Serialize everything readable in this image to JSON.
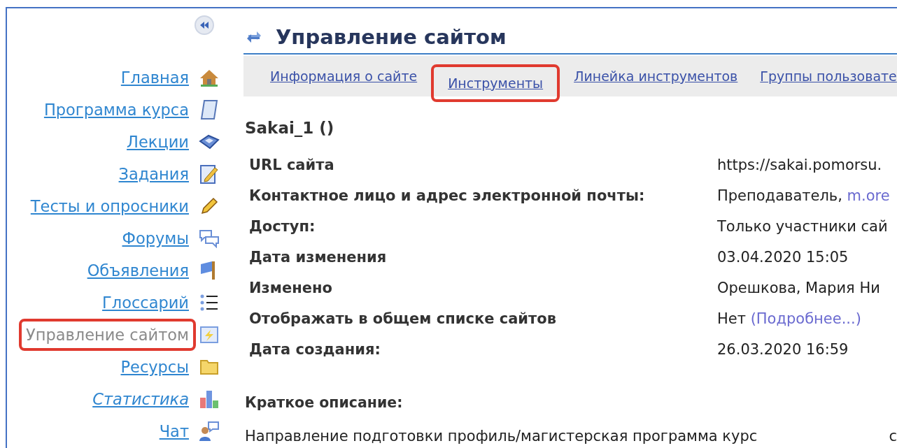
{
  "sidebar": {
    "items": [
      {
        "label": "Главная",
        "selected": false,
        "italic": false,
        "highlighted": false
      },
      {
        "label": "Программа курса",
        "selected": false,
        "italic": false,
        "highlighted": false
      },
      {
        "label": "Лекции",
        "selected": false,
        "italic": false,
        "highlighted": false
      },
      {
        "label": "Задания",
        "selected": false,
        "italic": false,
        "highlighted": false
      },
      {
        "label": "Тесты и опросники",
        "selected": false,
        "italic": false,
        "highlighted": false
      },
      {
        "label": "Форумы",
        "selected": false,
        "italic": false,
        "highlighted": false
      },
      {
        "label": "Объявления",
        "selected": false,
        "italic": false,
        "highlighted": false
      },
      {
        "label": "Глоссарий",
        "selected": false,
        "italic": false,
        "highlighted": false
      },
      {
        "label": "Управление сайтом",
        "selected": true,
        "italic": false,
        "highlighted": true
      },
      {
        "label": "Ресурсы",
        "selected": false,
        "italic": false,
        "highlighted": false
      },
      {
        "label": "Статистика",
        "selected": false,
        "italic": true,
        "highlighted": false
      },
      {
        "label": "Чат",
        "selected": false,
        "italic": false,
        "highlighted": false
      }
    ]
  },
  "page": {
    "title": "Управление сайтом",
    "tabs": [
      {
        "label": "Информация о сайте",
        "highlighted": false
      },
      {
        "label": "Инструменты",
        "highlighted": true
      },
      {
        "label": "Линейка инструментов",
        "highlighted": false
      },
      {
        "label": "Группы пользовате",
        "highlighted": false
      }
    ],
    "site_name": "Sakai_1 ()",
    "details": [
      {
        "label": "URL сайта",
        "value": "https://sakai.pomorsu."
      },
      {
        "label": "Контактное лицо и адрес электронной почты:",
        "value": "Преподаватель, ",
        "link": "m.ore"
      },
      {
        "label": "Доступ:",
        "value": "Только участники сай"
      },
      {
        "label": "Дата изменения",
        "value": "03.04.2020 15:05"
      },
      {
        "label": "Изменено",
        "value": "Орешкова, Мария Ни"
      },
      {
        "label": "Отображать в общем списке сайтов",
        "value": "Нет ",
        "link": "(Подробнее...)"
      },
      {
        "label": "Дата создания:",
        "value": "26.03.2020 16:59"
      }
    ],
    "description_heading": "Краткое описание:",
    "description": "Направление подготовки профиль/магистерская программа курс",
    "description_column_2": "с"
  }
}
